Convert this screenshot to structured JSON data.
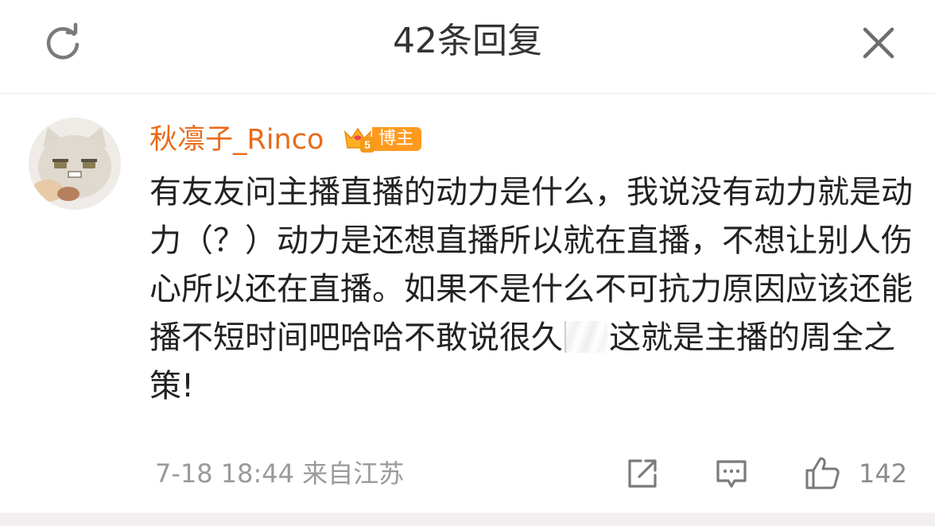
{
  "header": {
    "title": "42条回复",
    "refresh_icon": "refresh-icon",
    "close_icon": "close-icon"
  },
  "comment": {
    "username": "秋凛子_Rinco",
    "badge": {
      "level": "5",
      "label": "博主",
      "color": "#ff9a1f"
    },
    "text_part1": "有友友问主播直播的动力是什么，我说没有动力就是动力（？）动力是还想直播所以就在直播，不想让别人伤心所以还在直播。如果不是什么不可抗力原因应该还能播不短时间吧哈哈不敢说很久",
    "text_part2": "这就是主播的周全之策!",
    "timestamp": "7-18 18:44",
    "location": "来自江苏",
    "like_count": "142"
  },
  "colors": {
    "username": "#e86b1a",
    "text": "#222222",
    "meta": "#9a9a9a",
    "icon": "#7a7a7a"
  }
}
